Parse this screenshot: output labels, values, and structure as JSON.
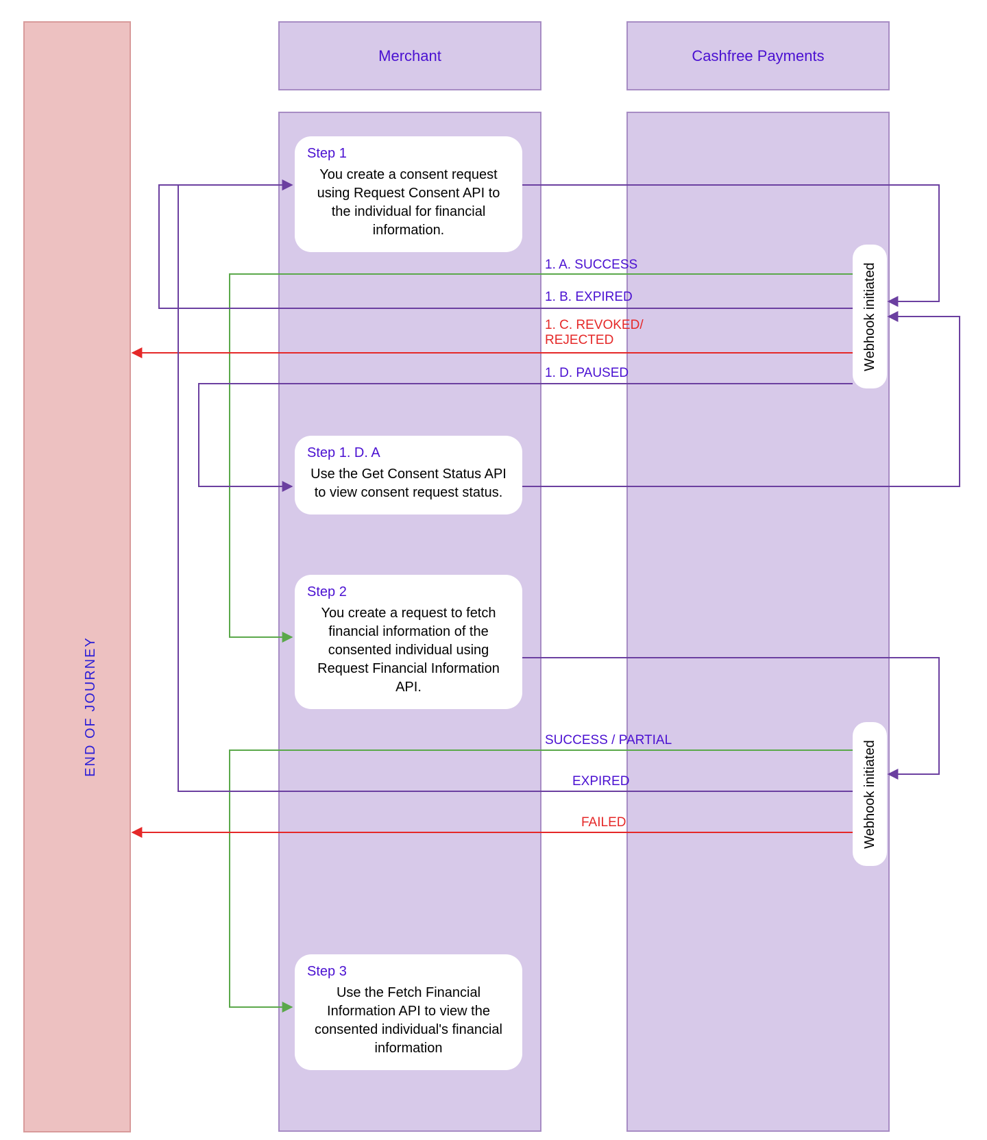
{
  "lanes": {
    "end": {
      "title": "END OF JOURNEY"
    },
    "merchant": {
      "title": "Merchant"
    },
    "cashfree": {
      "title": "Cashfree Payments"
    }
  },
  "steps": {
    "s1": {
      "title": "Step 1",
      "body": "You create a consent request using Request Consent API to the individual for financial information."
    },
    "s1d": {
      "title": "Step 1. D. A",
      "body": "Use the Get Consent Status API to view consent request status."
    },
    "s2": {
      "title": "Step 2",
      "body": "You create a request to fetch financial information of the consented individual using Request Financial Information API."
    },
    "s3": {
      "title": "Step 3",
      "body": "Use the Fetch Financial Information API to view the consented individual's financial information"
    }
  },
  "webhooks": {
    "wh1": "Webhook initiated",
    "wh2": "Webhook initiated"
  },
  "flow": {
    "a1": "1. A. SUCCESS",
    "b1": "1. B. EXPIRED",
    "c1": "1. C. REVOKED/ REJECTED",
    "d1": "1. D. PAUSED",
    "s2a": "SUCCESS / PARTIAL",
    "s2b": "EXPIRED",
    "s2c": "FAILED"
  }
}
